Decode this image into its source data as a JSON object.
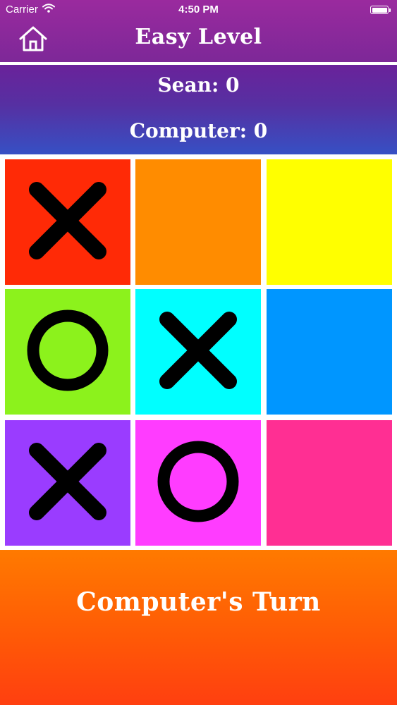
{
  "status_bar": {
    "carrier": "Carrier",
    "time": "4:50 PM",
    "wifi_icon": "wifi-icon",
    "battery_icon": "battery-icon"
  },
  "header": {
    "title": "Easy Level",
    "home_icon": "home-icon"
  },
  "scores": {
    "player": "Sean: 0",
    "computer": "Computer: 0"
  },
  "board": {
    "cells": [
      {
        "mark": "X",
        "color": "#ff2a06"
      },
      {
        "mark": "",
        "color": "#ff8c00"
      },
      {
        "mark": "",
        "color": "#ffff00"
      },
      {
        "mark": "O",
        "color": "#8cf21c"
      },
      {
        "mark": "X",
        "color": "#00ffff"
      },
      {
        "mark": "",
        "color": "#0096ff"
      },
      {
        "mark": "X",
        "color": "#9a3cff"
      },
      {
        "mark": "O",
        "color": "#ff3cff"
      },
      {
        "mark": "",
        "color": "#ff2f93"
      }
    ]
  },
  "footer": {
    "turn_text": "Computer's Turn"
  }
}
